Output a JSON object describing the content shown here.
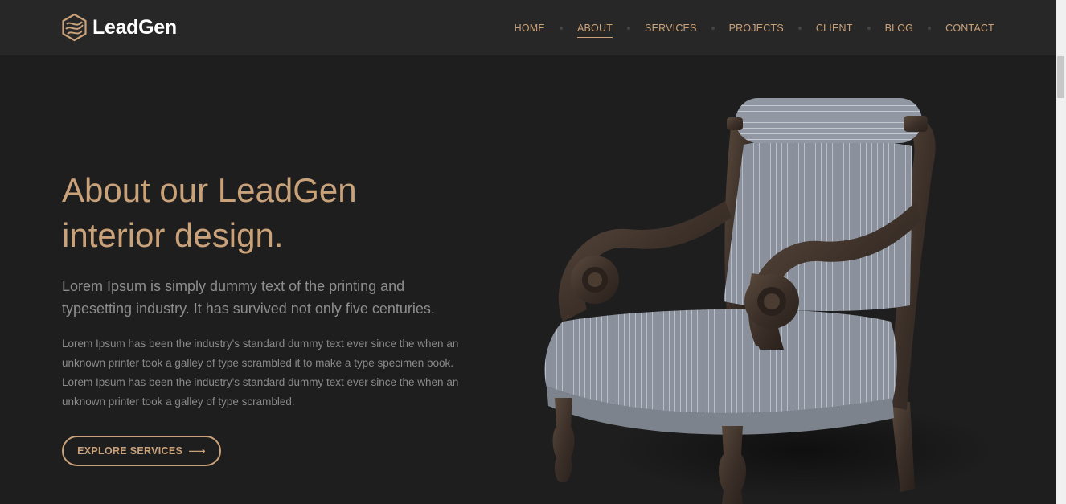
{
  "brand": {
    "name": "LeadGen",
    "logo_icon": "hexagon-logo-icon"
  },
  "nav": {
    "items": [
      {
        "label": "HOME",
        "active": false
      },
      {
        "label": "ABOUT",
        "active": true
      },
      {
        "label": "SERVICES",
        "active": false
      },
      {
        "label": "PROJECTS",
        "active": false
      },
      {
        "label": "CLIENT",
        "active": false
      },
      {
        "label": "BLOG",
        "active": false
      },
      {
        "label": "CONTACT",
        "active": false
      }
    ]
  },
  "hero": {
    "title_line1": "About our LeadGen",
    "title_line2": "interior design.",
    "lead": "Lorem Ipsum is simply dummy text of the printing and typesetting industry. It has survived not only five centuries.",
    "body": "Lorem Ipsum has been the industry's standard dummy text ever since the when an unknown printer took a galley of type scrambled it to make a type specimen book. Lorem Ipsum has been the industry's standard dummy text ever since the when an unknown printer took a galley of type scrambled.",
    "button_label": "EXPLORE SERVICES",
    "button_icon": "arrow-right-icon",
    "image": "armchair-image"
  },
  "colors": {
    "accent": "#c9a27a",
    "background": "#1e1e1e",
    "header_background": "#272727",
    "text_muted": "#8e8e8e"
  }
}
